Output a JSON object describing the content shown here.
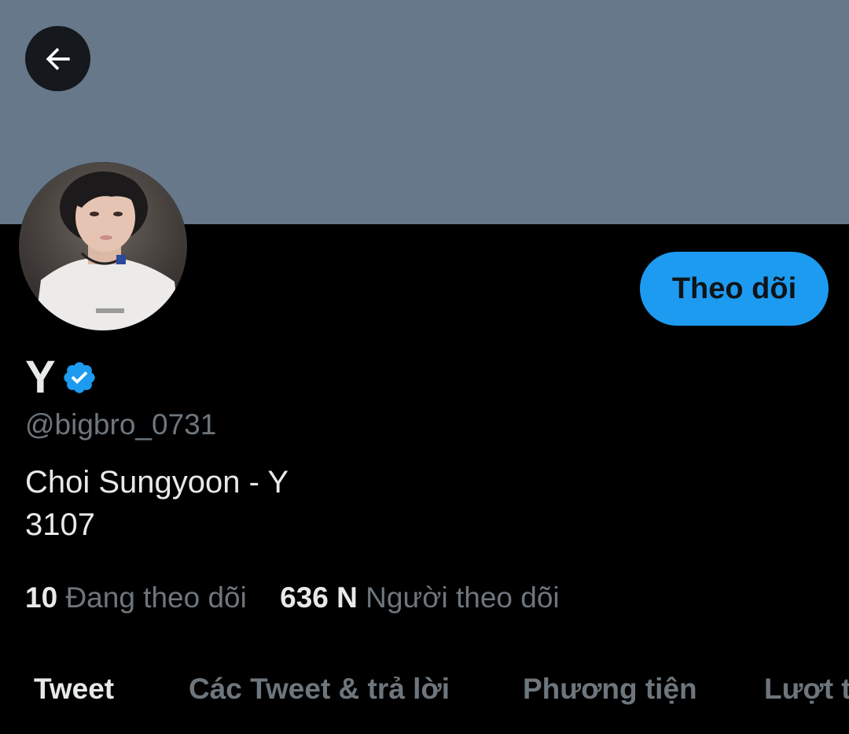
{
  "profile": {
    "display_name": "Y",
    "handle": "@bigbro_0731",
    "bio_line1": "Choi Sungyoon - Y",
    "bio_line2": "3107",
    "verified": true
  },
  "actions": {
    "follow_label": "Theo dõi"
  },
  "stats": {
    "following_count": "10",
    "following_label": "Đang theo dõi",
    "followers_count": "636 N",
    "followers_label": "Người theo dõi"
  },
  "tabs": [
    {
      "label": "Tweet",
      "active": true
    },
    {
      "label": "Các Tweet & trả lời",
      "active": false
    },
    {
      "label": "Phương tiện",
      "active": false
    },
    {
      "label": "Lượt thích",
      "active": false
    }
  ],
  "colors": {
    "banner": "#66788a",
    "accent": "#1d9bf0",
    "background": "#000000",
    "secondary_text": "#6e767d",
    "primary_text": "#e7e9ea"
  },
  "icons": {
    "back": "arrow-left-icon",
    "verified": "verified-badge-icon"
  }
}
